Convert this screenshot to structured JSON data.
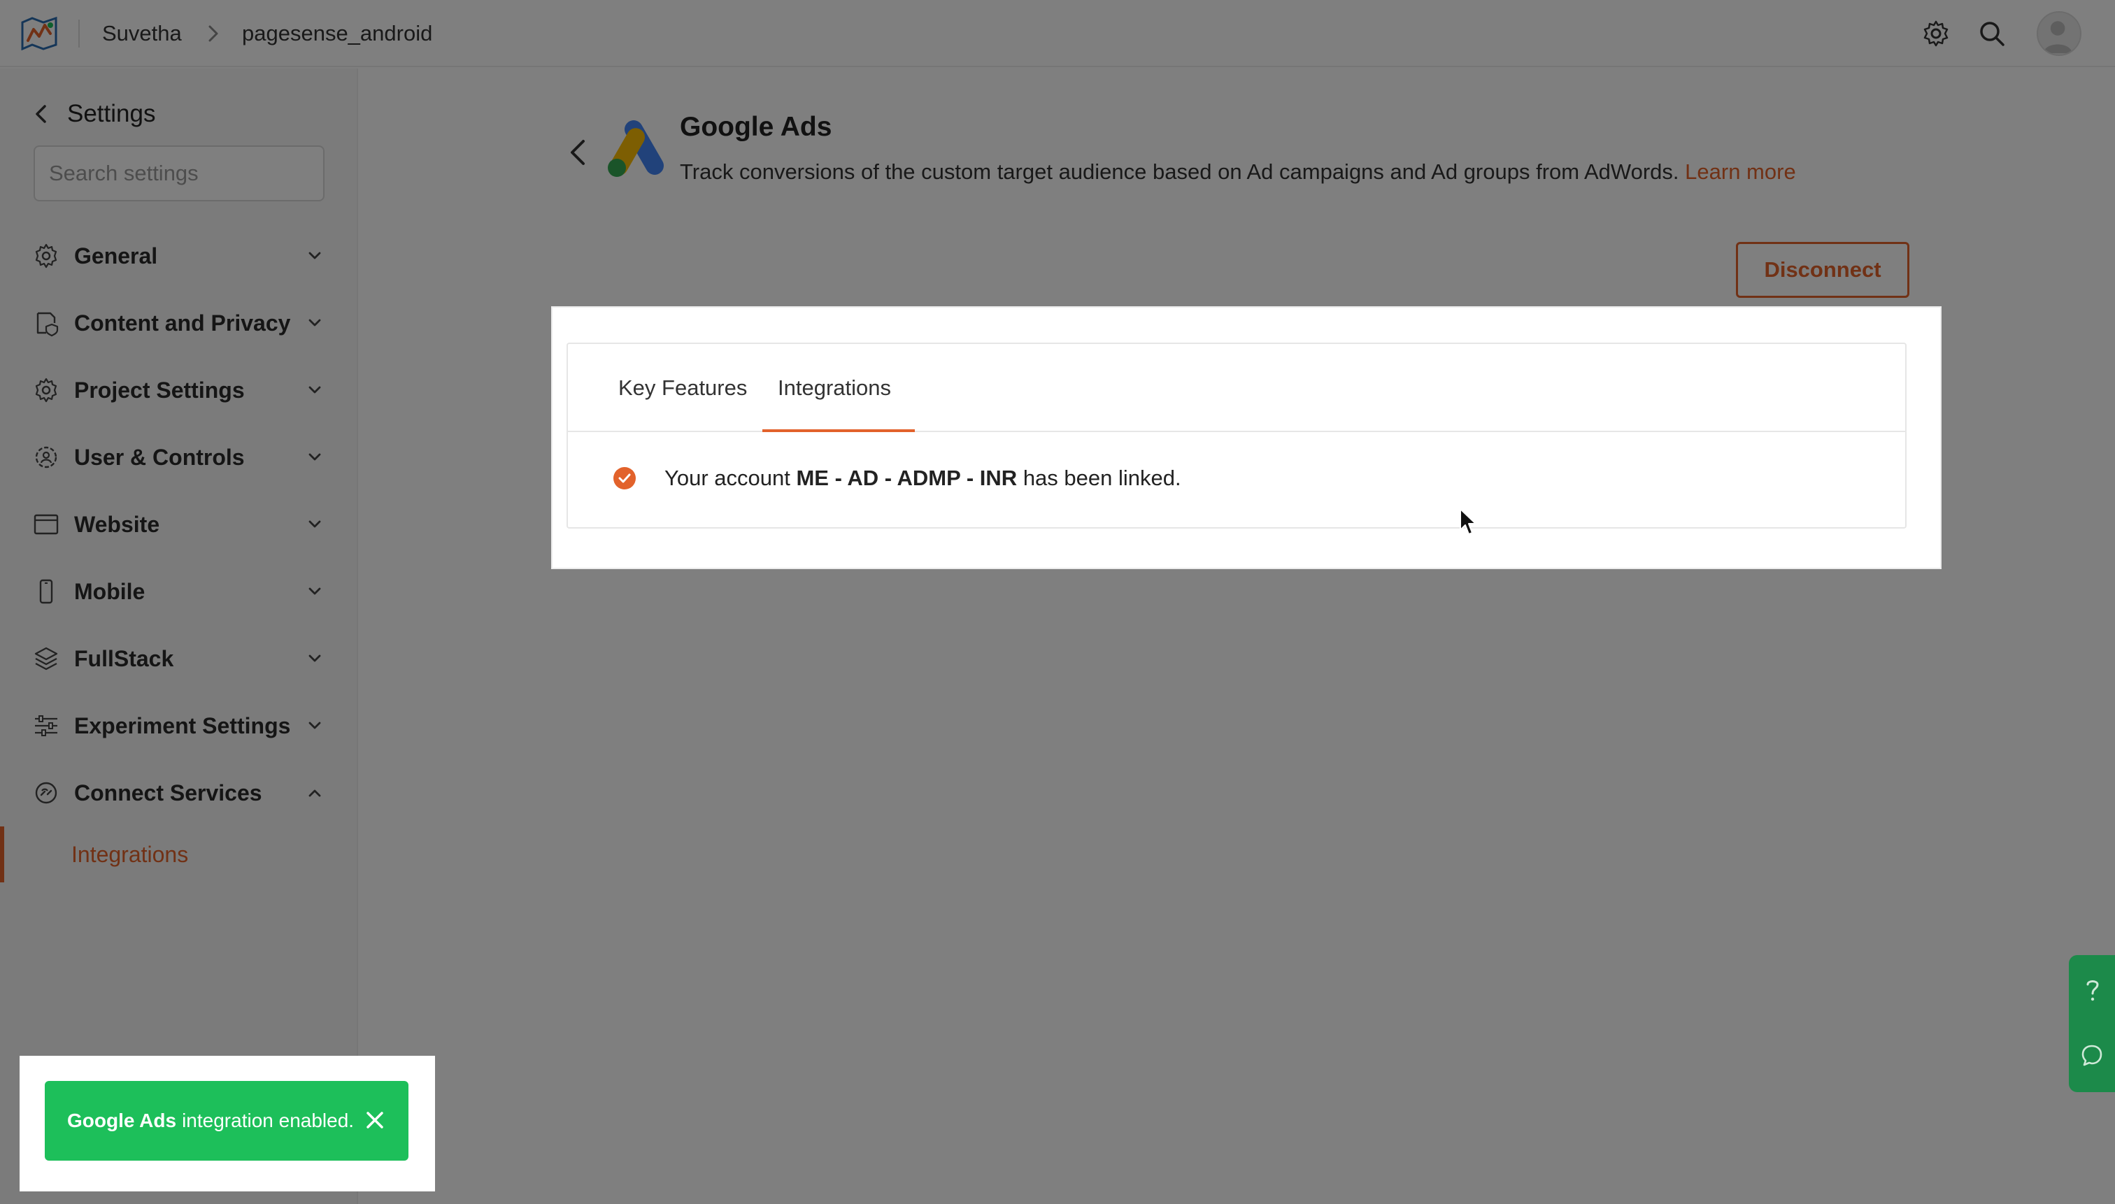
{
  "topbar": {
    "breadcrumb": [
      "Suvetha",
      "pagesense_android"
    ],
    "logo_icon": "pagesense-logo-icon",
    "settings_icon": "gear-icon",
    "search_icon": "search-icon",
    "avatar_icon": "user-avatar-icon"
  },
  "sidebar": {
    "title": "Settings",
    "search": {
      "placeholder": "Search settings",
      "value": ""
    },
    "items": [
      {
        "label": "General",
        "icon": "gear-icon",
        "expanded": false
      },
      {
        "label": "Content and Privacy",
        "icon": "privacy-shield-icon",
        "expanded": false
      },
      {
        "label": "Project Settings",
        "icon": "gear-icon",
        "expanded": false
      },
      {
        "label": "User & Controls",
        "icon": "user-gear-icon",
        "expanded": false
      },
      {
        "label": "Website",
        "icon": "browser-window-icon",
        "expanded": false
      },
      {
        "label": "Mobile",
        "icon": "mobile-phone-icon",
        "expanded": false
      },
      {
        "label": "FullStack",
        "icon": "stack-layers-icon",
        "expanded": false
      },
      {
        "label": "Experiment Settings",
        "icon": "sliders-icon",
        "expanded": false
      },
      {
        "label": "Connect Services",
        "icon": "connect-services-icon",
        "expanded": true
      }
    ],
    "sub_items": [
      {
        "label": "Integrations",
        "active": true
      }
    ]
  },
  "main": {
    "integration_title": "Google Ads",
    "description": "Track conversions of the custom target audience based on Ad campaigns and Ad groups from AdWords.",
    "learn_more": "Learn more",
    "disconnect_label": "Disconnect",
    "tabs": [
      {
        "label": "Key Features",
        "active": false
      },
      {
        "label": "Integrations",
        "active": true
      }
    ],
    "linked_message": {
      "prefix": "Your account",
      "account": "ME - AD - ADMP - INR",
      "suffix": "has been linked."
    }
  },
  "toast": {
    "bold": "Google Ads",
    "text": "integration enabled.",
    "close_icon": "close-icon"
  },
  "help_dock": {
    "help_icon": "question-mark-icon",
    "chat_icon": "chat-bubble-icon"
  },
  "colors": {
    "accent": "#e2622b",
    "toast_green": "#1dbf5a",
    "help_green": "#1c8a4a",
    "overlay": "rgba(0,0,0,0.5)"
  }
}
